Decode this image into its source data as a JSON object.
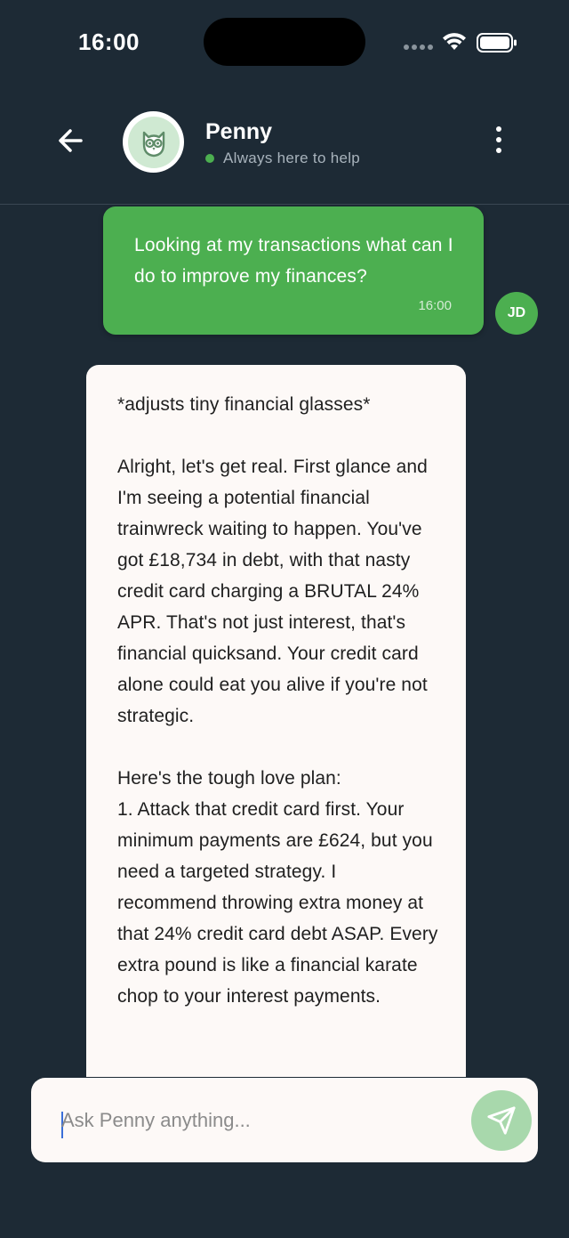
{
  "status_bar": {
    "time": "16:00"
  },
  "header": {
    "contact_name": "Penny",
    "status_text": "Always here to help"
  },
  "messages": {
    "user": {
      "text": "Looking at my transactions what can I do to improve my finances?",
      "time": "16:00",
      "avatar_initials": "JD"
    },
    "bot": {
      "text": "*adjusts tiny financial glasses*\n\nAlright, let's get real. First glance and I'm seeing a potential financial trainwreck waiting to happen. You've got £18,734 in debt, with that nasty credit card charging a BRUTAL 24% APR. That's not just interest, that's financial quicksand. Your credit card alone could eat you alive if you're not strategic.\n\nHere's the tough love plan:\n1. Attack that credit card first. Your minimum payments are £624, but you need a targeted strategy. I recommend throwing extra money at that 24% credit card debt ASAP. Every extra pound is like a financial karate chop to your interest payments."
    }
  },
  "input": {
    "placeholder": "Ask Penny anything...",
    "value": ""
  },
  "colors": {
    "background": "#1d2a35",
    "accent": "#4caf50",
    "bubble_bot": "#fdf9f7",
    "send_button": "#a8d8ac"
  },
  "icons": {
    "back": "arrow-left-icon",
    "avatar": "owl-icon",
    "more": "more-vertical-icon",
    "send": "send-icon"
  }
}
